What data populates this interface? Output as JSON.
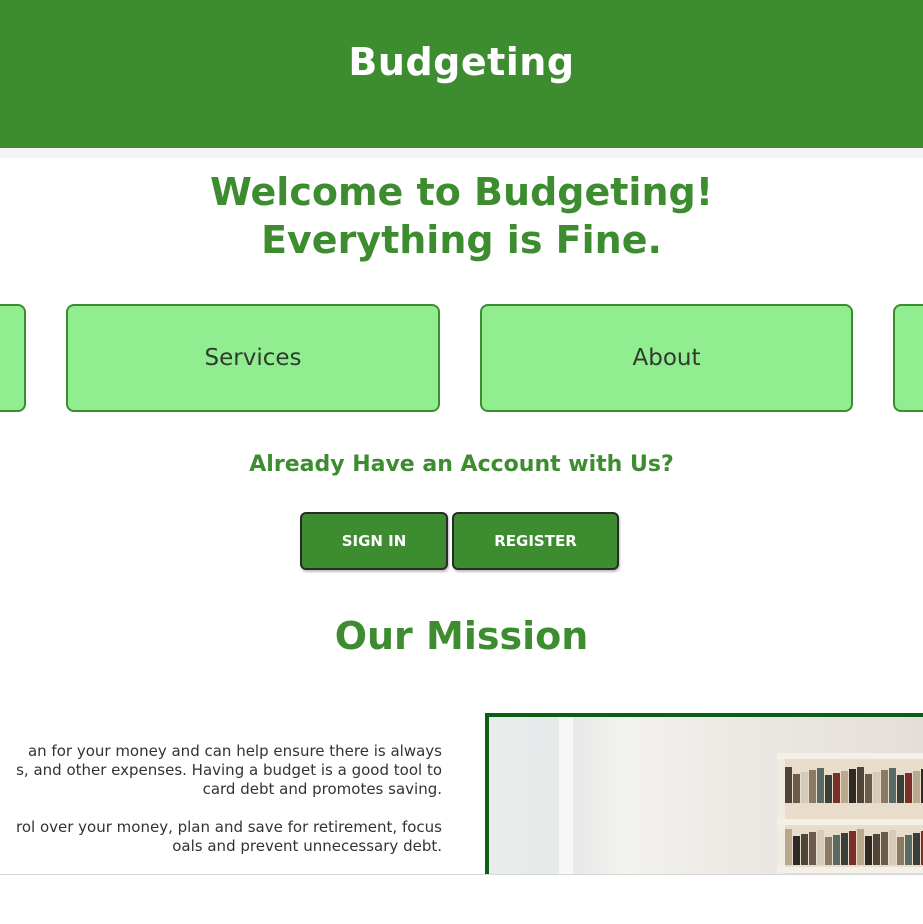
{
  "header": {
    "title": "Budgeting"
  },
  "welcome": {
    "line1": "Welcome to Budgeting!",
    "line2": "Everything is Fine."
  },
  "nav_cards": {
    "services": "Services",
    "about": "About"
  },
  "account": {
    "question": "Already Have an Account with Us?",
    "signin_label": "SIGN IN",
    "register_label": "REGISTER"
  },
  "mission": {
    "title": "Our Mission",
    "para1_lines": [
      "an for your money and can help ensure there is always",
      "s, and other expenses. Having a budget is a good tool to",
      "card debt and promotes saving."
    ],
    "para2_lines": [
      "rol over your money, plan and save for retirement, focus",
      "oals and prevent unnecessary debt."
    ]
  },
  "colors": {
    "brand_green": "#3d8c30",
    "card_green": "#90ee90",
    "photo_border": "#0b5d17"
  }
}
